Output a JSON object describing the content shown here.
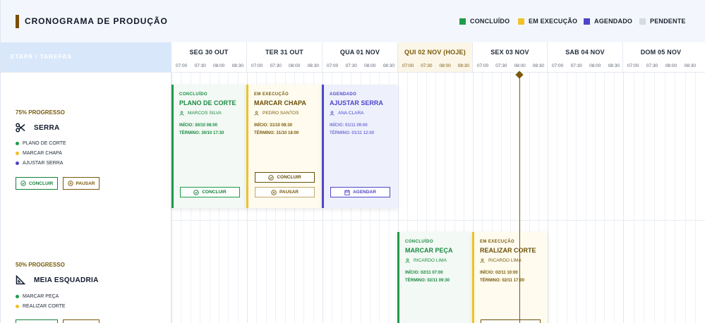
{
  "header": {
    "title": "CRONOGRAMA DE PRODUÇÃO",
    "legend": [
      {
        "label": "CONCLUÍDO",
        "color": "#1f9b4a"
      },
      {
        "label": "EM EXECUÇÃO",
        "color": "#f0c12a"
      },
      {
        "label": "AGENDADO",
        "color": "#4d45c9"
      },
      {
        "label": "PENDENTE",
        "color": "#d5dae3"
      }
    ]
  },
  "grid": {
    "stage_header": "ETAPA / TAREFAS",
    "days": [
      {
        "label": "SEG 30 OUT",
        "times": [
          "07:00",
          "07:30",
          "08:00",
          "08:30"
        ]
      },
      {
        "label": "TER 31 OUT",
        "times": [
          "07:00",
          "07:30",
          "08:00",
          "08:30"
        ]
      },
      {
        "label": "QUA 01 NOV",
        "times": [
          "07:00",
          "07:30",
          "08:00",
          "08:30"
        ]
      },
      {
        "label": "QUI 02 NOV (HOJE)",
        "times": [
          "07:00",
          "07:30",
          "08:00",
          "08:30"
        ]
      },
      {
        "label": "SEX 03 NOV",
        "times": [
          "07:00",
          "07:30",
          "08:00",
          "08:30"
        ]
      },
      {
        "label": "SAB 04 NOV",
        "times": [
          "07:00",
          "07:30",
          "08:00",
          "08:30"
        ]
      },
      {
        "label": "DOM 05 NOV",
        "times": [
          "07:00",
          "07:30",
          "08:00",
          "08:30"
        ]
      }
    ]
  },
  "stages": [
    {
      "progress": "75% PROGRESSO",
      "name": "SERRA",
      "icon": "scissors-icon",
      "tasks": [
        {
          "label": "PLANO DE CORTE",
          "color": "#1f9b4a"
        },
        {
          "label": "MARCAR CHAPA",
          "color": "#f0c12a"
        },
        {
          "label": "AJUSTAR SERRA",
          "color": "#4d45c9"
        }
      ],
      "buttons": {
        "primary": "CONCLUIR",
        "secondary": "PAUSAR"
      }
    },
    {
      "progress": "50% PROGRESSO",
      "name": "MEIA ESQUADRIA",
      "icon": "set-square-icon",
      "tasks": [
        {
          "label": "MARCAR PEÇA",
          "color": "#1f9b4a"
        },
        {
          "label": "REALIZAR CORTE",
          "color": "#f0c12a"
        }
      ]
    }
  ],
  "cards": [
    {
      "status": "CONCLUÍDO",
      "title": "PLANO DE CORTE",
      "person": "MARCOS SILVA",
      "start": "INÍCIO: 30/10 08:00",
      "end": "TÉRMINO: 30/10 17:30",
      "buttons": [
        "CONCLUIR"
      ]
    },
    {
      "status": "EM EXECUÇÃO",
      "title": "MARCAR CHAPA",
      "person": "PEDRO SANTOS",
      "start": "INÍCIO: 31/10 08:30",
      "end": "TÉRMINO: 31/10 18:00",
      "buttons": [
        "CONCLUIR",
        "PAUSAR"
      ]
    },
    {
      "status": "AGENDADO",
      "title": "AJUSTAR SERRA",
      "person": "ANA CLARA",
      "start": "INÍCIO: 01/11 09:00",
      "end": "TÉRMINO: 01/11 12:00",
      "buttons": [
        "AGENDAR"
      ]
    },
    {
      "status": "CONCLUÍDO",
      "title": "MARCAR PEÇA",
      "person": "RICARDO LIMA",
      "start": "INÍCIO: 02/11 07:00",
      "end": "TÉRMINO: 02/11 09:30"
    },
    {
      "status": "EM EXECUÇÃO",
      "title": "REALIZAR CORTE",
      "person": "RICARDO LIMA",
      "start": "INÍCIO: 02/11 10:00",
      "end": "TÉRMINO: 02/11 17:00"
    }
  ]
}
